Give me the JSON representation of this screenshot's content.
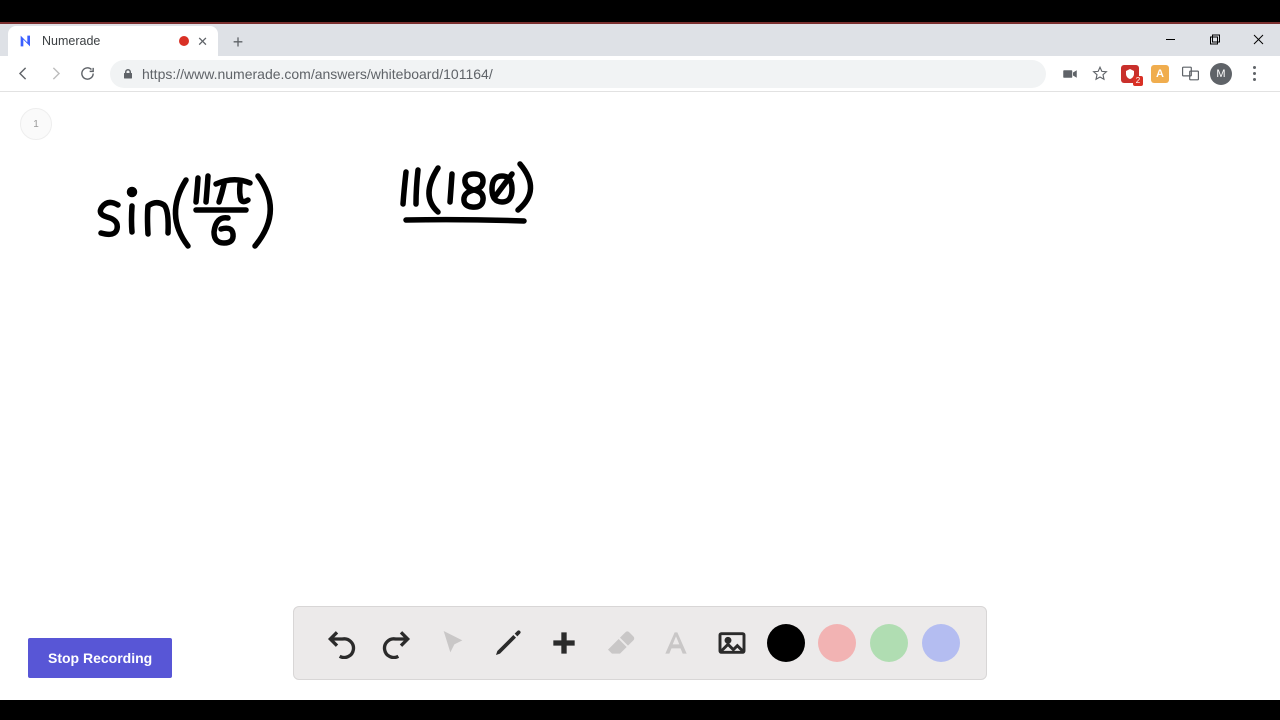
{
  "browser": {
    "tab": {
      "title": "Numerade",
      "recording": true
    },
    "url_display": "https://www.numerade.com/answers/whiteboard/101164/"
  },
  "page": {
    "badge": "1",
    "stop_button": "Stop Recording"
  },
  "whiteboard_tools": {
    "swatches": {
      "black": "#000000",
      "red": "#f2b3b3",
      "green": "#b0ddb2",
      "blue": "#b4bdf1"
    }
  },
  "handwritten_content": {
    "expr1": "sin(11π/6)",
    "expr2": "11(180) / ..."
  },
  "profile": {
    "initial": "M"
  },
  "extensions": {
    "ext1_badge": "2",
    "ext2_letter": "A"
  }
}
